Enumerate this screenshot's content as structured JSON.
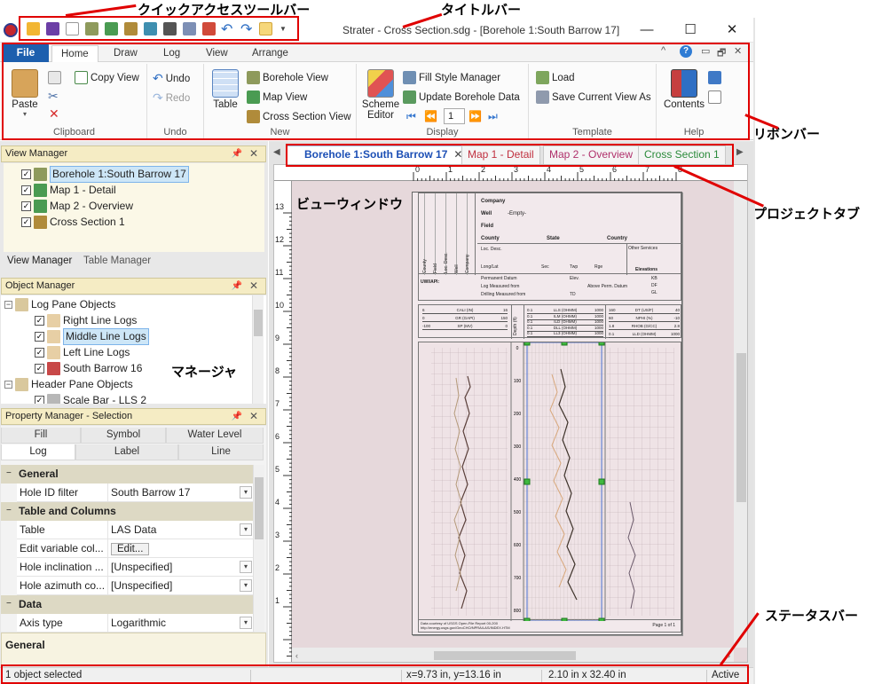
{
  "annotations": {
    "quick_access_toolbar": "クイックアクセスツールバー",
    "title_bar": "タイトルバー",
    "ribbon_bar": "リボンバー",
    "project_tabs": "プロジェクトタブ",
    "view_window": "ビューウィンドウ",
    "managers": "マネージャ",
    "status_bar": "ステータスバー"
  },
  "window": {
    "title": "Strater - Cross Section.sdg - [Borehole 1:South Barrow 17]",
    "minimize": "—",
    "maximize": "☐",
    "close": "✕"
  },
  "ribbon": {
    "tabs": [
      "Home",
      "Draw",
      "Log",
      "View",
      "Arrange"
    ],
    "file_label": "File",
    "active_tab": "Home",
    "right_icons": [
      "^",
      "?",
      "▭",
      "🗗",
      "✕"
    ],
    "clipboard": {
      "label": "Clipboard",
      "paste": "Paste",
      "copy_view": "Copy View"
    },
    "undo_group": {
      "label": "Undo",
      "undo": "Undo",
      "redo": "Redo"
    },
    "new_group": {
      "label": "New",
      "table": "Table",
      "borehole_view": "Borehole View",
      "map_view": "Map View",
      "cross_section_view": "Cross Section View"
    },
    "display": {
      "label": "Display",
      "scheme_editor_line1": "Scheme",
      "scheme_editor_line2": "Editor",
      "fill_style_manager": "Fill Style Manager",
      "update_borehole_data": "Update Borehole Data",
      "page_value": "1"
    },
    "template": {
      "label": "Template",
      "load": "Load",
      "save_current_view_as": "Save Current View As"
    },
    "help": {
      "label": "Help",
      "contents": "Contents"
    }
  },
  "view_manager": {
    "title": "View Manager",
    "items": [
      "Borehole 1:South Barrow 17",
      "Map 1 - Detail",
      "Map 2 - Overview",
      "Cross Section 1"
    ],
    "tabs": [
      "View Manager",
      "Table Manager"
    ]
  },
  "object_manager": {
    "title": "Object Manager",
    "items": [
      "Log Pane Objects",
      "Right Line Logs",
      "Middle Line Logs",
      "Left Line Logs",
      "South Barrow 16",
      "Header Pane Objects",
      "Scale Bar - LLS 2"
    ]
  },
  "property_manager": {
    "title": "Property Manager - Selection",
    "tabs_row1": [
      "Fill",
      "Symbol",
      "Water Level"
    ],
    "tabs_row2": [
      "Log",
      "Label",
      "Line"
    ],
    "categories": {
      "general": "General",
      "table_columns": "Table and Columns",
      "data": "Data"
    },
    "rows": [
      {
        "key": "Hole ID filter",
        "value": "South Barrow 17"
      },
      {
        "key": "Table",
        "value": "LAS Data"
      },
      {
        "key": "Edit variable col...",
        "value": "Edit..."
      },
      {
        "key": "Hole inclination ...",
        "value": "[Unspecified]"
      },
      {
        "key": "Hole azimuth co...",
        "value": "[Unspecified]"
      },
      {
        "key": "Axis type",
        "value": "Logarithmic"
      }
    ],
    "footer": "General"
  },
  "doc_tabs": [
    {
      "label": "Borehole 1:South Barrow 17",
      "color": "#1c4fb5"
    },
    {
      "label": "Map 1 - Detail",
      "color": "#c0303f"
    },
    {
      "label": "Map 2 - Overview",
      "color": "#b0306b"
    },
    {
      "label": "Cross Section 1",
      "color": "#2a8a3a"
    }
  ],
  "ruler": {
    "top": [
      "0",
      "1",
      "2",
      "3",
      "4",
      "5",
      "6",
      "7",
      "8"
    ],
    "left": [
      "13",
      "12",
      "11",
      "10",
      "9",
      "8",
      "7",
      "6",
      "5",
      "4",
      "3",
      "2",
      "1"
    ]
  },
  "page": {
    "header_fields": {
      "company": "Company",
      "well": "Well",
      "well_value": "-Empty-",
      "field": "Field",
      "county": "County",
      "state": "State",
      "country": "Country",
      "loc_desc": "Loc. Desc.",
      "other_services": "Other Services",
      "long_lat": "Long/Lat",
      "sec": "Sec",
      "twp": "Twp",
      "rge": "Rge",
      "elevations": "Elevations",
      "uwi": "UWI/API:",
      "perm_datum": "Permanent Datum",
      "elev": "Elev.",
      "log_measured": "Log Measured from",
      "above_perm": "Above Perm. Datum",
      "drilling_measured": "Drilling Measured from",
      "td": "TD",
      "kb": "KB",
      "df": "DF",
      "gl": "GL"
    },
    "vertical_labels": [
      "County",
      "Field",
      "Loc. Desc.",
      "Well",
      "Company"
    ],
    "legend_left": [
      {
        "name": "CALI (IN)",
        "lo": "6",
        "hi": "16"
      },
      {
        "name": "GR (GAPI)",
        "lo": "0",
        "hi": "150"
      },
      {
        "name": "SP (MV)",
        "lo": "-100",
        "hi": "0"
      }
    ],
    "depth_label": "Depth (ft)",
    "legend_mid": [
      {
        "name": "LLS (OHMM)",
        "lo": "0.1",
        "hi": "1000"
      },
      {
        "name": "ILM (OHMM)",
        "lo": "0.1",
        "hi": "1000"
      },
      {
        "name": "ILD (OHMM)",
        "lo": "0.1",
        "hi": "1000"
      },
      {
        "name": "DLL (OHMM)",
        "lo": "0.1",
        "hi": "1000"
      },
      {
        "name": "LL3 (OHMM)",
        "lo": "0.1",
        "hi": "1000"
      }
    ],
    "legend_right": [
      {
        "name": "DT (US/F)",
        "lo": "160",
        "hi": "40"
      },
      {
        "name": "NPHI (%)",
        "lo": "60",
        "hi": "-10"
      },
      {
        "name": "RHOB (G/CC)",
        "lo": "1.8",
        "hi": "2.8"
      },
      {
        "name": "LLD (OHMM)",
        "lo": "0.1",
        "hi": "1000"
      }
    ],
    "depth_ticks": [
      "0",
      "100",
      "200",
      "300",
      "400",
      "500",
      "600",
      "700",
      "800"
    ],
    "footer_left_line1": "Data courtesy of USGS Open-File Report 00-200",
    "footer_left_line2": "http://energy.usgs.gov/GeoCHO/NPRA/LAS/INDEX.HTM",
    "footer_right": "Page 1 of 1"
  },
  "status": {
    "selection": "1 object selected",
    "coords": "x=9.73 in, y=13.16 in",
    "size": "2.10 in x 32.40 in",
    "state": "Active"
  }
}
